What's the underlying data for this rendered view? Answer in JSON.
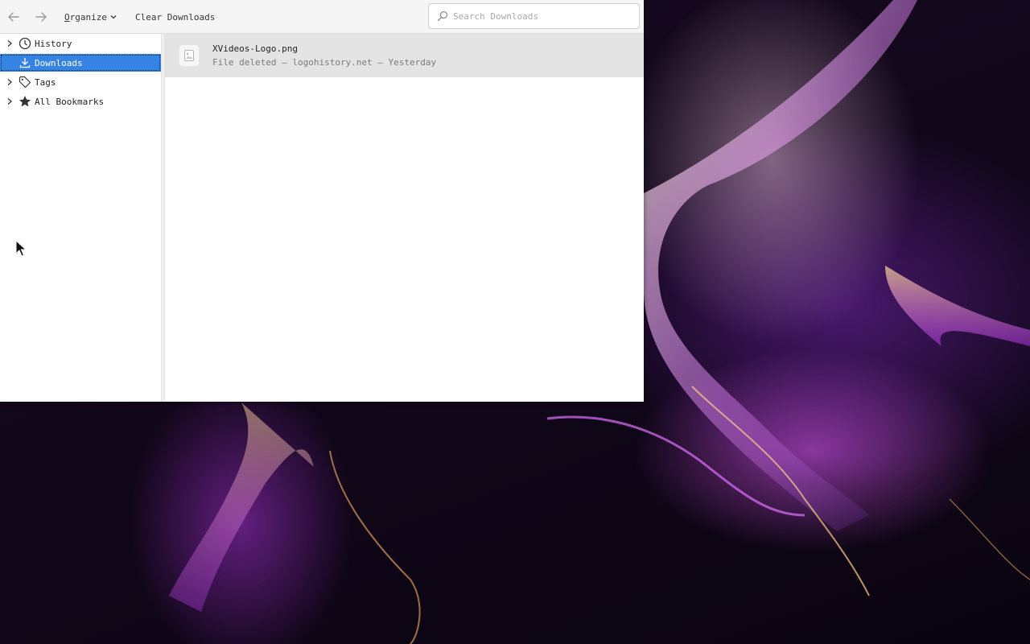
{
  "toolbar": {
    "back_icon": "arrow-left-icon",
    "forward_icon": "arrow-right-icon",
    "organize_label": "Organize",
    "organize_underlined_letter": "O",
    "organize_rest": "rganize",
    "clear_downloads_label": "Clear Downloads",
    "search_placeholder": "Search Downloads",
    "search_value": ""
  },
  "sidebar": {
    "items": [
      {
        "label": "History",
        "icon": "clock-icon",
        "expandable": true,
        "selected": false
      },
      {
        "label": "Downloads",
        "icon": "download-icon",
        "expandable": false,
        "selected": true
      },
      {
        "label": "Tags",
        "icon": "tag-icon",
        "expandable": true,
        "selected": false
      },
      {
        "label": "All Bookmarks",
        "icon": "star-icon",
        "expandable": true,
        "selected": false
      }
    ]
  },
  "downloads": [
    {
      "name": "XVideos-Logo.png",
      "status": "File deleted — logohistory.net — Yesterday",
      "icon": "image-file-icon"
    }
  ],
  "colors": {
    "selection": "#3584e4",
    "row_highlight": "#e4e4e4",
    "toolbar_bg": "#f5f5f5"
  }
}
